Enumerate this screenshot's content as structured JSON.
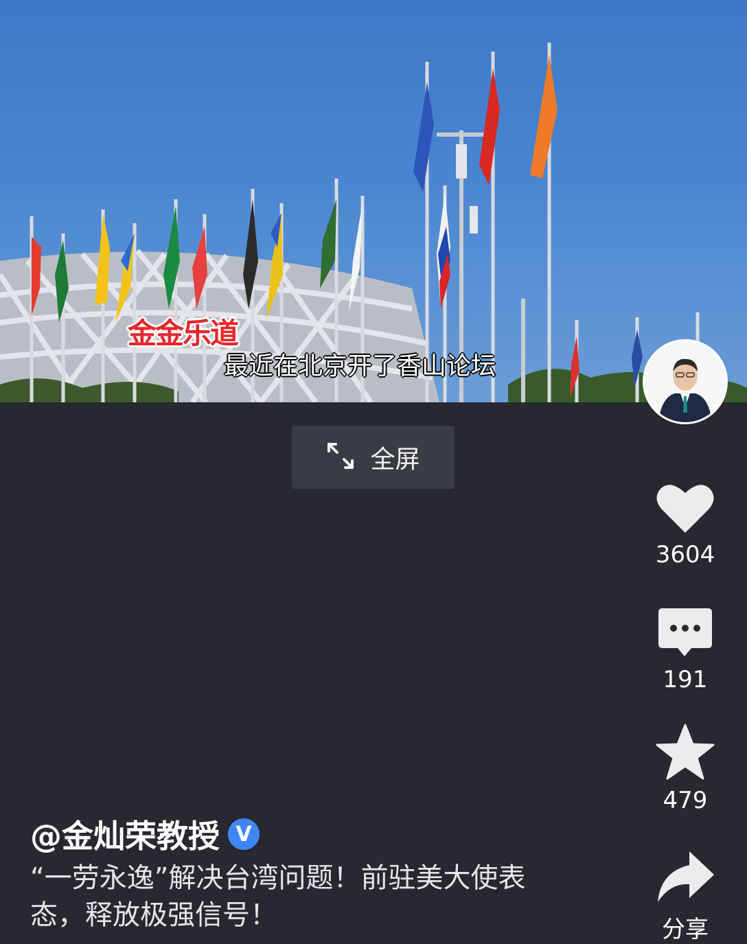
{
  "video": {
    "logo_text": "金金乐道",
    "subtitle": "最近在北京开了香山论坛"
  },
  "fullscreen": {
    "icon": "expand-arrows-icon",
    "label": "全屏"
  },
  "sidebar": {
    "avatar_icon": "author-avatar",
    "like": {
      "icon": "heart-icon",
      "count": "3604"
    },
    "comment": {
      "icon": "comment-bubble-icon",
      "count": "191"
    },
    "favorite": {
      "icon": "star-icon",
      "count": "479"
    },
    "share": {
      "icon": "share-arrow-icon",
      "label": "分享"
    }
  },
  "post": {
    "author": "@金灿荣教授",
    "verified_badge": "V",
    "description": "“一劳永逸”解决台湾问题！前驻美大使表态，释放极强信号！"
  },
  "colors": {
    "background": "#272830",
    "sky": "#4a86d0",
    "badge": "#3f86f5"
  }
}
